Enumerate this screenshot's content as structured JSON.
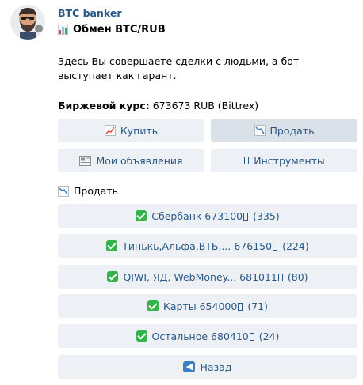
{
  "message": {
    "author": "BTC banker",
    "title": "Обмен BTC/RUB",
    "body": "Здесь Вы совершаете сделки с людьми, а бот выступает как гарант.",
    "rate_label": "Биржевой курс:",
    "rate_value": "673673 RUB (Bittrex)",
    "section_label": "Продать"
  },
  "keyboard": {
    "buy": "Купить",
    "sell": "Продать",
    "my_ads": "Мои объявления",
    "tools": "Инструменты",
    "offers": [
      {
        "label": "Сбербанк 673100",
        "count": "(335)"
      },
      {
        "label": "Тинькь,Альфа,ВТБ,... 676150",
        "count": "(224)"
      },
      {
        "label": "QIWI, ЯД, WebMoney... 681011",
        "count": "(80)"
      },
      {
        "label": "Карты 654000",
        "count": "(71)"
      },
      {
        "label": "Остальное 680410",
        "count": "(24)"
      }
    ],
    "back": "Назад"
  },
  "icons": {
    "avatar": "bearded-man-avatar",
    "title": "bar-chart-icon",
    "buy": "chart-increasing-icon",
    "sell": "chart-decreasing-icon",
    "my_ads": "newspaper-icon",
    "tools": "wrench-icon",
    "offer": "check-mark-button-icon",
    "back": "back-arrow-icon"
  },
  "colors": {
    "link": "#2a5885",
    "button_bg": "#edf1f5",
    "button_active_bg": "#dae1e8",
    "check_green": "#33b34a"
  }
}
